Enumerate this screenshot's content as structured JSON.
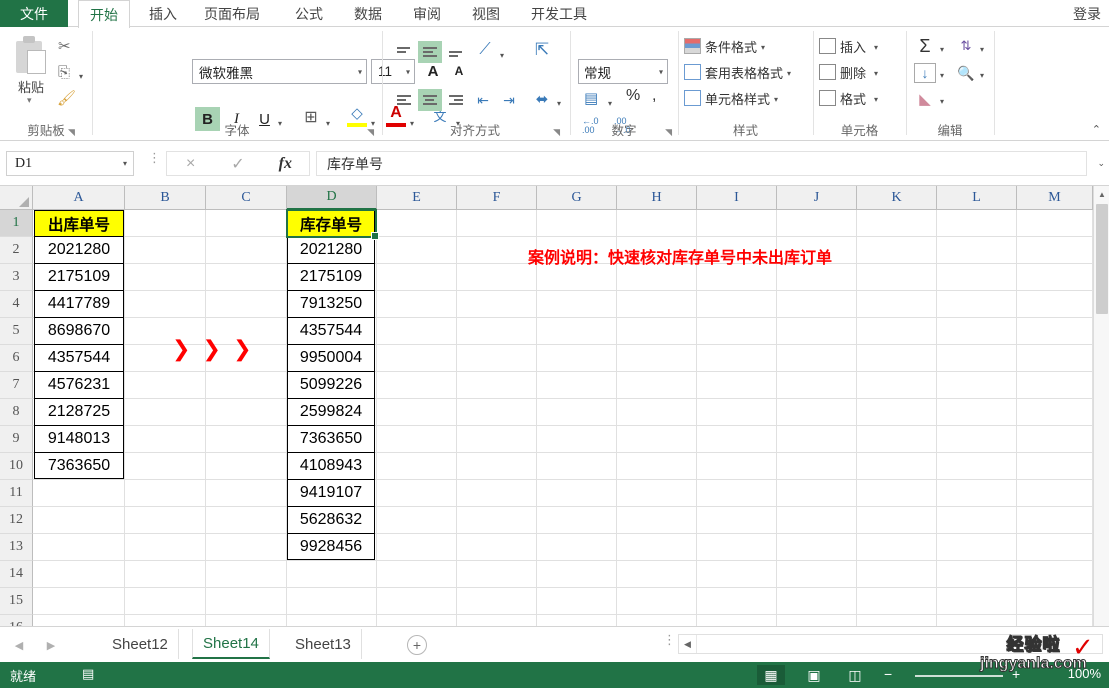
{
  "window": {
    "signin_label": "登录"
  },
  "ribbon_tabs": {
    "file": "文件",
    "items": [
      {
        "label": "开始",
        "active": true
      },
      {
        "label": "插入",
        "active": false
      },
      {
        "label": "页面布局",
        "active": false
      },
      {
        "label": "公式",
        "active": false
      },
      {
        "label": "数据",
        "active": false
      },
      {
        "label": "审阅",
        "active": false
      },
      {
        "label": "视图",
        "active": false
      },
      {
        "label": "开发工具",
        "active": false
      }
    ]
  },
  "ribbon": {
    "clipboard": {
      "group_label": "剪贴板",
      "paste_label": "粘贴",
      "cut_icon": "scissors-icon",
      "copy_icon": "copy-icon",
      "format_painter_icon": "format-painter-icon"
    },
    "font": {
      "group_label": "字体",
      "font_name": "微软雅黑",
      "font_size": "11",
      "grow_font": "A",
      "shrink_font": "A",
      "bold": "B",
      "italic": "I",
      "underline": "U",
      "border_icon": "borders-icon",
      "fill_icon": "fill-color-icon",
      "fill_letter": "◇",
      "font_color_letter": "A",
      "phonetic_label": "文"
    },
    "alignment": {
      "group_label": "对齐方式",
      "orientation_icon": "text-orientation-icon",
      "wrap_text_icon": "wrap-text-icon",
      "merge_icon": "merge-cells-icon",
      "decrease_indent_icon": "decrease-indent-icon",
      "increase_indent_icon": "increase-indent-icon"
    },
    "number": {
      "group_label": "数字",
      "format_value": "常规",
      "accounting_icon": "accounting-format-icon",
      "percent_label": "%",
      "comma_label": ",",
      "increase_decimal": ".00",
      "decrease_decimal": ".00"
    },
    "styles": {
      "group_label": "样式",
      "items": [
        {
          "label": "条件格式",
          "icon": "conditional-formatting-icon"
        },
        {
          "label": "套用表格格式",
          "icon": "format-as-table-icon"
        },
        {
          "label": "单元格样式",
          "icon": "cell-styles-icon"
        }
      ]
    },
    "cells": {
      "group_label": "单元格",
      "items": [
        {
          "label": "插入",
          "icon": "insert-cells-icon"
        },
        {
          "label": "删除",
          "icon": "delete-cells-icon"
        },
        {
          "label": "格式",
          "icon": "format-cells-icon"
        }
      ]
    },
    "editing": {
      "group_label": "编辑",
      "autosum_icon": "autosum-sigma-icon",
      "sort_icon": "sort-az-icon",
      "fill_icon": "fill-down-icon",
      "find_icon": "find-binoculars-icon",
      "clear_icon": "clear-eraser-icon"
    },
    "collapse_icon": "chevron-up-icon"
  },
  "formula_bar": {
    "name_box": "D1",
    "cancel_icon": "×",
    "confirm_icon": "✓",
    "fx_label": "fx",
    "value": "库存单号",
    "expand_icon": "chevron-down-icon"
  },
  "grid": {
    "columns": [
      "A",
      "B",
      "C",
      "D",
      "E",
      "F",
      "G",
      "H",
      "I",
      "J",
      "K",
      "L",
      "M"
    ],
    "selected_column": "D",
    "selected_row": 1,
    "rows": [
      1,
      2,
      3,
      4,
      5,
      6,
      7,
      8,
      9,
      10,
      11,
      12,
      13,
      14,
      15,
      16
    ],
    "col_a": {
      "header": "出库单号",
      "values": [
        "2021280",
        "2175109",
        "4417789",
        "8698670",
        "4357544",
        "4576231",
        "2128725",
        "9148013",
        "7363650"
      ]
    },
    "col_d": {
      "header": "库存单号",
      "values": [
        "2021280",
        "2175109",
        "7913250",
        "4357544",
        "9950004",
        "5099226",
        "2599824",
        "7363650",
        "4108943",
        "9419107",
        "5628632",
        "9928456"
      ]
    },
    "arrows_marker": "❯ ❯ ❯",
    "annotation": "案例说明：快速核对库存单号中未出库订单",
    "header_fill_color": "#ffff00",
    "annotation_color": "#ff0000",
    "selection_color": "#217346"
  },
  "sheet_tabs": {
    "prev_icon": "◀",
    "next_icon": "▶",
    "items": [
      {
        "label": "Sheet12",
        "active": false
      },
      {
        "label": "Sheet14",
        "active": true
      },
      {
        "label": "Sheet13",
        "active": false
      }
    ],
    "add_label": "+"
  },
  "status_bar": {
    "ready_text": "就绪",
    "macro_icon": "record-macro-icon",
    "views": [
      {
        "icon": "normal-view-icon",
        "glyph": "▦",
        "active": true
      },
      {
        "icon": "page-layout-view-icon",
        "glyph": "▣",
        "active": false
      },
      {
        "icon": "page-break-view-icon",
        "glyph": "◫",
        "active": false
      }
    ],
    "zoom_out": "−",
    "zoom_in": "+",
    "zoom_level": "100%"
  },
  "watermark": {
    "cn": "经验啦",
    "en": "jingyanla.com",
    "check": "✓"
  }
}
